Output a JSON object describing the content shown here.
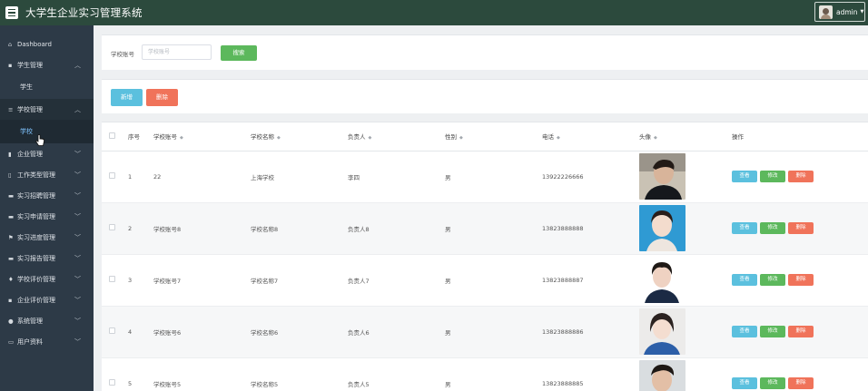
{
  "app": {
    "title": "大学生企业实习管理系统",
    "user": "admin"
  },
  "sidebar": {
    "items": [
      {
        "label": "Dashboard",
        "icon": "home-icon"
      },
      {
        "label": "学生管理",
        "icon": "grid-icon",
        "sub": [
          "学生"
        ]
      },
      {
        "label": "学校管理",
        "icon": "list-icon",
        "sub": [
          "学校"
        ]
      },
      {
        "label": "企业管理",
        "icon": "bar-icon"
      },
      {
        "label": "工作类型管理",
        "icon": "chart-icon"
      },
      {
        "label": "实习招聘管理",
        "icon": "card-icon"
      },
      {
        "label": "实习申请管理",
        "icon": "card-icon"
      },
      {
        "label": "实习进度管理",
        "icon": "flag-icon"
      },
      {
        "label": "实习报告管理",
        "icon": "card-icon"
      },
      {
        "label": "学校评价管理",
        "icon": "pin-icon"
      },
      {
        "label": "企业评价管理",
        "icon": "grid-icon"
      },
      {
        "label": "系统管理",
        "icon": "user-icon"
      },
      {
        "label": "用户资料",
        "icon": "doc-icon"
      }
    ]
  },
  "search": {
    "label": "学校账号",
    "placeholder": "学校账号",
    "button": "搜索"
  },
  "actions": {
    "add": "新增",
    "delete": "删除"
  },
  "table": {
    "columns": [
      "序号",
      "学校账号",
      "学校名称",
      "负责人",
      "性别",
      "电话",
      "头像",
      "操作"
    ],
    "ops": {
      "view": "查看",
      "edit": "修改",
      "delete": "删除"
    },
    "rows": [
      {
        "idx": "1",
        "account": "22",
        "name": "上海学校",
        "leader": "李四",
        "gender": "男",
        "phone": "13922226666"
      },
      {
        "idx": "2",
        "account": "学校账号8",
        "name": "学校名称8",
        "leader": "负责人8",
        "gender": "男",
        "phone": "13823888888"
      },
      {
        "idx": "3",
        "account": "学校账号7",
        "name": "学校名称7",
        "leader": "负责人7",
        "gender": "男",
        "phone": "13823888887"
      },
      {
        "idx": "4",
        "account": "学校账号6",
        "name": "学校名称6",
        "leader": "负责人6",
        "gender": "男",
        "phone": "13823888886"
      },
      {
        "idx": "5",
        "account": "学校账号5",
        "name": "学校名称5",
        "leader": "负责人5",
        "gender": "男",
        "phone": "13823888885"
      }
    ]
  },
  "colors": {
    "topbar": "#2c4a3d",
    "sidebar": "#2d3a47",
    "info": "#5bc0de",
    "success": "#5cb85c",
    "danger": "#f0735a"
  }
}
